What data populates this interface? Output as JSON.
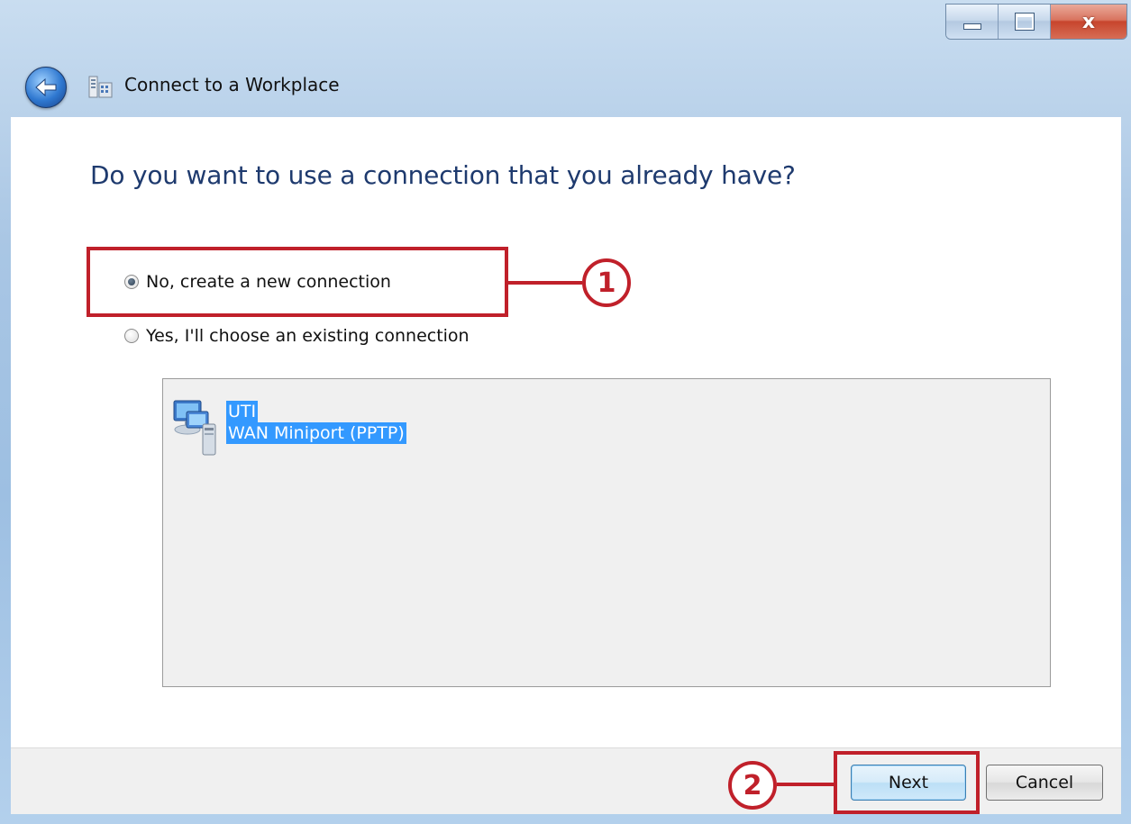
{
  "window": {
    "title": "Connect to a Workplace",
    "caption_buttons": {
      "close_glyph": "x"
    }
  },
  "wizard": {
    "heading": "Do you want to use a connection that you already have?",
    "options": [
      {
        "label": "No, create a new connection",
        "selected": true
      },
      {
        "label": "Yes, I'll choose an existing connection",
        "selected": false
      }
    ],
    "connections": [
      {
        "name": "UTI",
        "device": "WAN Miniport (PPTP)",
        "icon": "network-computer-icon",
        "selected": true
      }
    ]
  },
  "footer": {
    "next_label": "Next",
    "cancel_label": "Cancel"
  },
  "annotations": {
    "step1": "1",
    "step2": "2",
    "color": "#c0202a"
  },
  "colors": {
    "heading": "#1e3a6e",
    "selection": "#3399ff",
    "titlebar": "#a9c6e4"
  }
}
